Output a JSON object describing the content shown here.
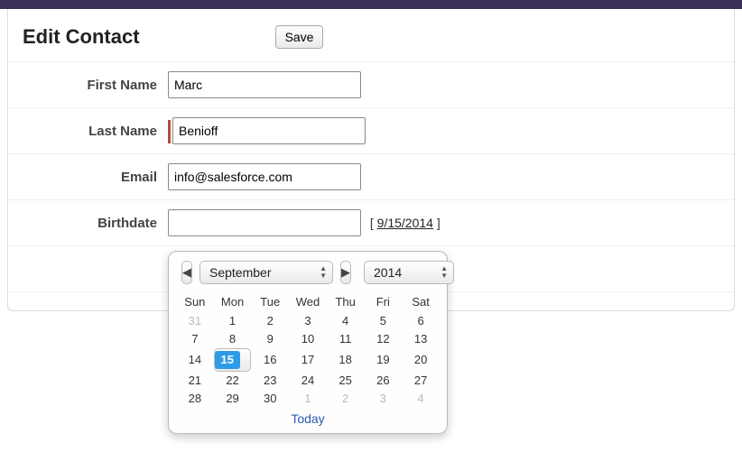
{
  "header": {
    "title": "Edit Contact",
    "save": "Save"
  },
  "fields": {
    "first_name": {
      "label": "First Name",
      "value": "Marc"
    },
    "last_name": {
      "label": "Last Name",
      "value": "Benioff"
    },
    "email": {
      "label": "Email",
      "value": "info@salesforce.com"
    },
    "birthdate": {
      "label": "Birthdate",
      "value": "",
      "hint_open": "[ ",
      "hint_link": "9/15/2014",
      "hint_close": " ]"
    }
  },
  "datepicker": {
    "month": "September",
    "year": "2014",
    "dow": [
      "Sun",
      "Mon",
      "Tue",
      "Wed",
      "Thu",
      "Fri",
      "Sat"
    ],
    "weeks": [
      [
        {
          "d": 31,
          "o": true
        },
        {
          "d": 1
        },
        {
          "d": 2
        },
        {
          "d": 3
        },
        {
          "d": 4
        },
        {
          "d": 5
        },
        {
          "d": 6
        }
      ],
      [
        {
          "d": 7
        },
        {
          "d": 8
        },
        {
          "d": 9
        },
        {
          "d": 10
        },
        {
          "d": 11
        },
        {
          "d": 12
        },
        {
          "d": 13
        }
      ],
      [
        {
          "d": 14
        },
        {
          "d": 15,
          "sel": true
        },
        {
          "d": 16
        },
        {
          "d": 17
        },
        {
          "d": 18
        },
        {
          "d": 19
        },
        {
          "d": 20
        }
      ],
      [
        {
          "d": 21
        },
        {
          "d": 22
        },
        {
          "d": 23
        },
        {
          "d": 24
        },
        {
          "d": 25
        },
        {
          "d": 26
        },
        {
          "d": 27
        }
      ],
      [
        {
          "d": 28
        },
        {
          "d": 29
        },
        {
          "d": 30
        },
        {
          "d": 1,
          "o": true
        },
        {
          "d": 2,
          "o": true
        },
        {
          "d": 3,
          "o": true
        },
        {
          "d": 4,
          "o": true
        }
      ]
    ],
    "today": "Today"
  }
}
